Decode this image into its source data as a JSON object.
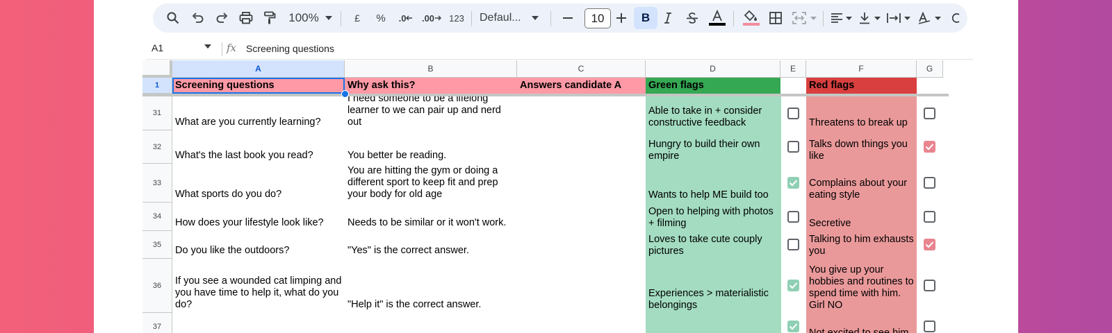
{
  "colors": {
    "background_left": "#f2607a",
    "background_right": "#b14aa0",
    "header_pink": "#ff99a6",
    "green_header": "#34a853",
    "red_header": "#d93f3f",
    "green_fill": "#a3dcc1",
    "red_fill": "#ea999a",
    "selection": "#1a73e8"
  },
  "toolbar": {
    "zoom": "100%",
    "currency": "£",
    "percent": "%",
    "decrease_decimals": ".0",
    "increase_decimals": ".00",
    "number_format": "123",
    "font_name": "Defaul...",
    "font_size": "10",
    "bold": "B",
    "icons": [
      "search-icon",
      "undo-icon",
      "redo-icon",
      "print-icon",
      "paint-format-icon",
      "zoom-dropdown-icon",
      "font-dropdown-icon",
      "decrease-font-icon",
      "increase-font-icon",
      "italic-icon",
      "strikethrough-icon",
      "text-color-icon",
      "fill-color-icon",
      "borders-icon",
      "merge-cells-icon",
      "halign-icon",
      "valign-icon",
      "text-wrap-icon",
      "text-rotation-icon"
    ]
  },
  "formula_bar": {
    "name_box": "A1",
    "fx": "fx",
    "value": "Screening questions"
  },
  "columns": [
    "A",
    "B",
    "C",
    "D",
    "E",
    "F",
    "G"
  ],
  "header_row": {
    "row_number": "1",
    "a": "Screening questions",
    "b": "Why ask this?",
    "c": "Answers candidate A",
    "d": "Green flags",
    "f": "Red flags"
  },
  "rows": [
    {
      "num": "31",
      "a": "What are you currently learning?",
      "b": "I need someone to be a lifelong\nlearner to we can pair up and nerd\nout",
      "d": "Able to take in + consider\nconstructive feedback",
      "e_checked": false,
      "f": "Threatens to break up",
      "g_checked": false
    },
    {
      "num": "32",
      "a": "What's the last book you read?",
      "b": "You better be reading.",
      "d": "Hungry to build their own\nempire",
      "e_checked": false,
      "f": "Talks down things you\nlike",
      "g_checked": true
    },
    {
      "num": "33",
      "a": "What sports do you do?",
      "b": "You are hitting the gym or doing a\ndifferent sport to keep fit and prep\nyour body for old age",
      "d": "Wants to help ME build too",
      "e_checked": true,
      "f": "Complains about your\neating style",
      "g_checked": false
    },
    {
      "num": "34",
      "a": "How does your lifestyle look like?",
      "b": "Needs to be similar or it won't work.",
      "d": "Open to helping with photos\n+ filming",
      "e_checked": false,
      "f": "Secretive",
      "g_checked": false
    },
    {
      "num": "35",
      "a": "Do you like the outdoors?",
      "b": "\"Yes\" is the correct answer.",
      "d": "Loves to take cute couply\npictures",
      "e_checked": false,
      "f": "Talking to him exhausts\nyou",
      "g_checked": true
    },
    {
      "num": "36",
      "a": "If you see a wounded cat limping and\nyou have time to help it, what do you\ndo?",
      "b": "\"Help it\" is the correct answer.",
      "d": "Experiences > materialistic\nbelongings",
      "e_checked": true,
      "f": "You give up your\nhobbies and routines to\nspend time with him.\nGirl NO",
      "g_checked": false
    },
    {
      "num": "37",
      "a": "",
      "b": "",
      "d": "",
      "e_checked": true,
      "f": "Not excited to see him",
      "g_checked": false
    }
  ]
}
